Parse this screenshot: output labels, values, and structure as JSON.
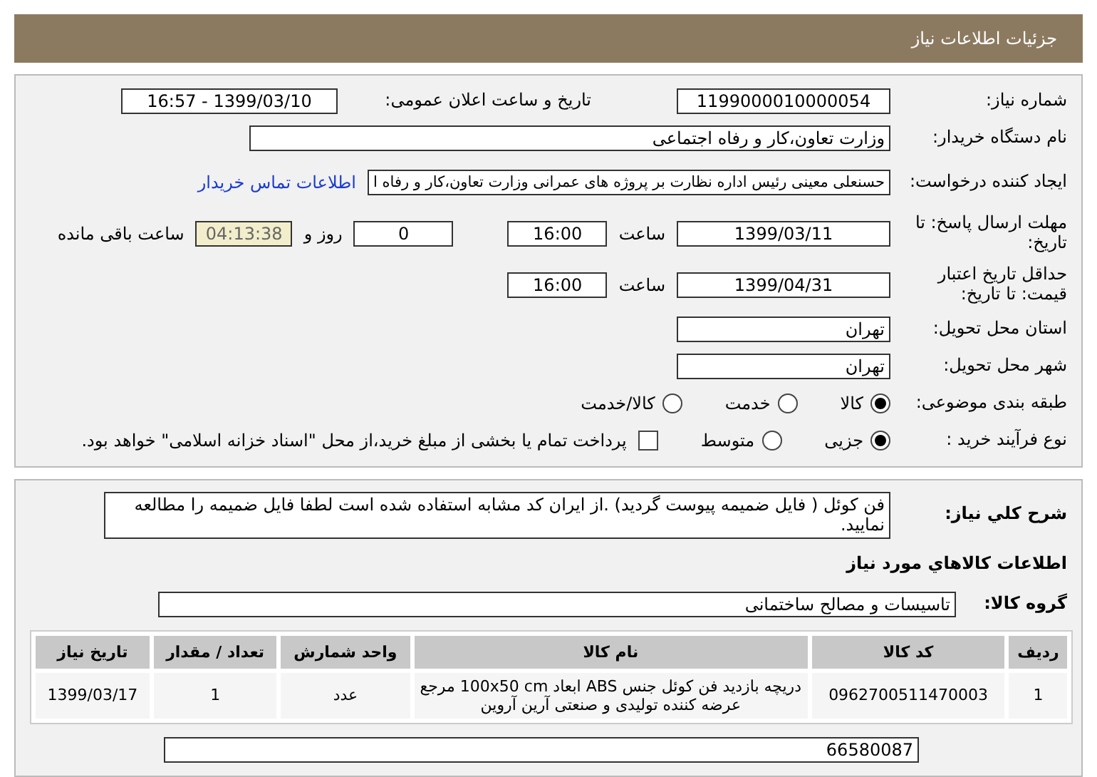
{
  "header": {
    "title": "جزئیات اطلاعات نیاز"
  },
  "need_number": {
    "label": "شماره نیاز:",
    "value": "1199000010000054"
  },
  "announce": {
    "label": "تاریخ و ساعت اعلان عمومی:",
    "value": "1399/03/10 - 16:57"
  },
  "buyer": {
    "label": "نام دستگاه خریدار:",
    "value": "وزارت تعاون،کار و رفاه اجتماعی"
  },
  "requester": {
    "label": "ایجاد کننده درخواست:",
    "value": "حسنعلی معینی رئیس اداره نظارت بر پروژه های عمرانی وزارت تعاون،کار و رفاه ا",
    "link": "اطلاعات تماس خریدار"
  },
  "deadline": {
    "label": "مهلت ارسال پاسخ: تا تاریخ:",
    "date": "1399/03/11",
    "time_label": "ساعت",
    "time": "16:00",
    "days": "0",
    "days_label": "روز و",
    "remaining": "04:13:38",
    "remaining_label": "ساعت باقی مانده"
  },
  "validity": {
    "label": "حداقل تاریخ اعتبار قیمت: تا تاریخ:",
    "date": "1399/04/31",
    "time_label": "ساعت",
    "time": "16:00"
  },
  "province": {
    "label": "استان محل تحویل:",
    "value": "تهران"
  },
  "city": {
    "label": "شهر محل تحویل:",
    "value": "تهران"
  },
  "category": {
    "label": "طبقه بندی موضوعی:",
    "options": [
      {
        "label": "کالا",
        "selected": true
      },
      {
        "label": "خدمت",
        "selected": false
      },
      {
        "label": "کالا/خدمت",
        "selected": false
      }
    ]
  },
  "process": {
    "label": "نوع فرآیند خرید :",
    "options": [
      {
        "label": "جزیی",
        "selected": true
      },
      {
        "label": "متوسط",
        "selected": false
      }
    ],
    "treasury": {
      "label": "پرداخت تمام یا بخشی از مبلغ خرید،از محل \"اسناد خزانه اسلامی\" خواهد بود.",
      "checked": false
    }
  },
  "description": {
    "label": "شرح کلي نیاز:",
    "value": "فن کوئل ( فایل ضمیمه پیوست گردید) .از ایران کد مشابه استفاده شده است لطفا فایل ضمیمه را مطالعه نمایید."
  },
  "goods_heading": "اطلاعات کالاهاي مورد نیاز",
  "goods_group": {
    "label": "گروه کالا:",
    "value": "تاسیسات و مصالح ساختمانی"
  },
  "table": {
    "columns": [
      "ردیف",
      "کد کالا",
      "نام کالا",
      "واحد شمارش",
      "تعداد / مقدار",
      "تاریخ نیاز"
    ],
    "rows": [
      [
        "1",
        "0962700511470003",
        "دریچه بازدید فن کوئل جنس ABS ابعاد 100x50 cm مرجع عرضه کننده تولیدی و صنعتی آرین آروین",
        "عدد",
        "1",
        "1399/03/17"
      ]
    ]
  },
  "contact": {
    "value": "66580087"
  }
}
